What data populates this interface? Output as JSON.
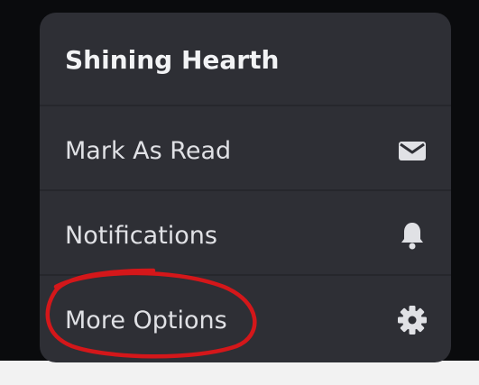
{
  "menu": {
    "title": "Shining Hearth",
    "items": [
      {
        "label": "Mark As Read",
        "icon": "envelope-icon"
      },
      {
        "label": "Notifications",
        "icon": "bell-icon"
      },
      {
        "label": "More Options",
        "icon": "gear-icon"
      }
    ]
  },
  "colors": {
    "menu_background": "#2e2f35",
    "text": "#e0e1e5",
    "annotation": "#d4171a"
  }
}
